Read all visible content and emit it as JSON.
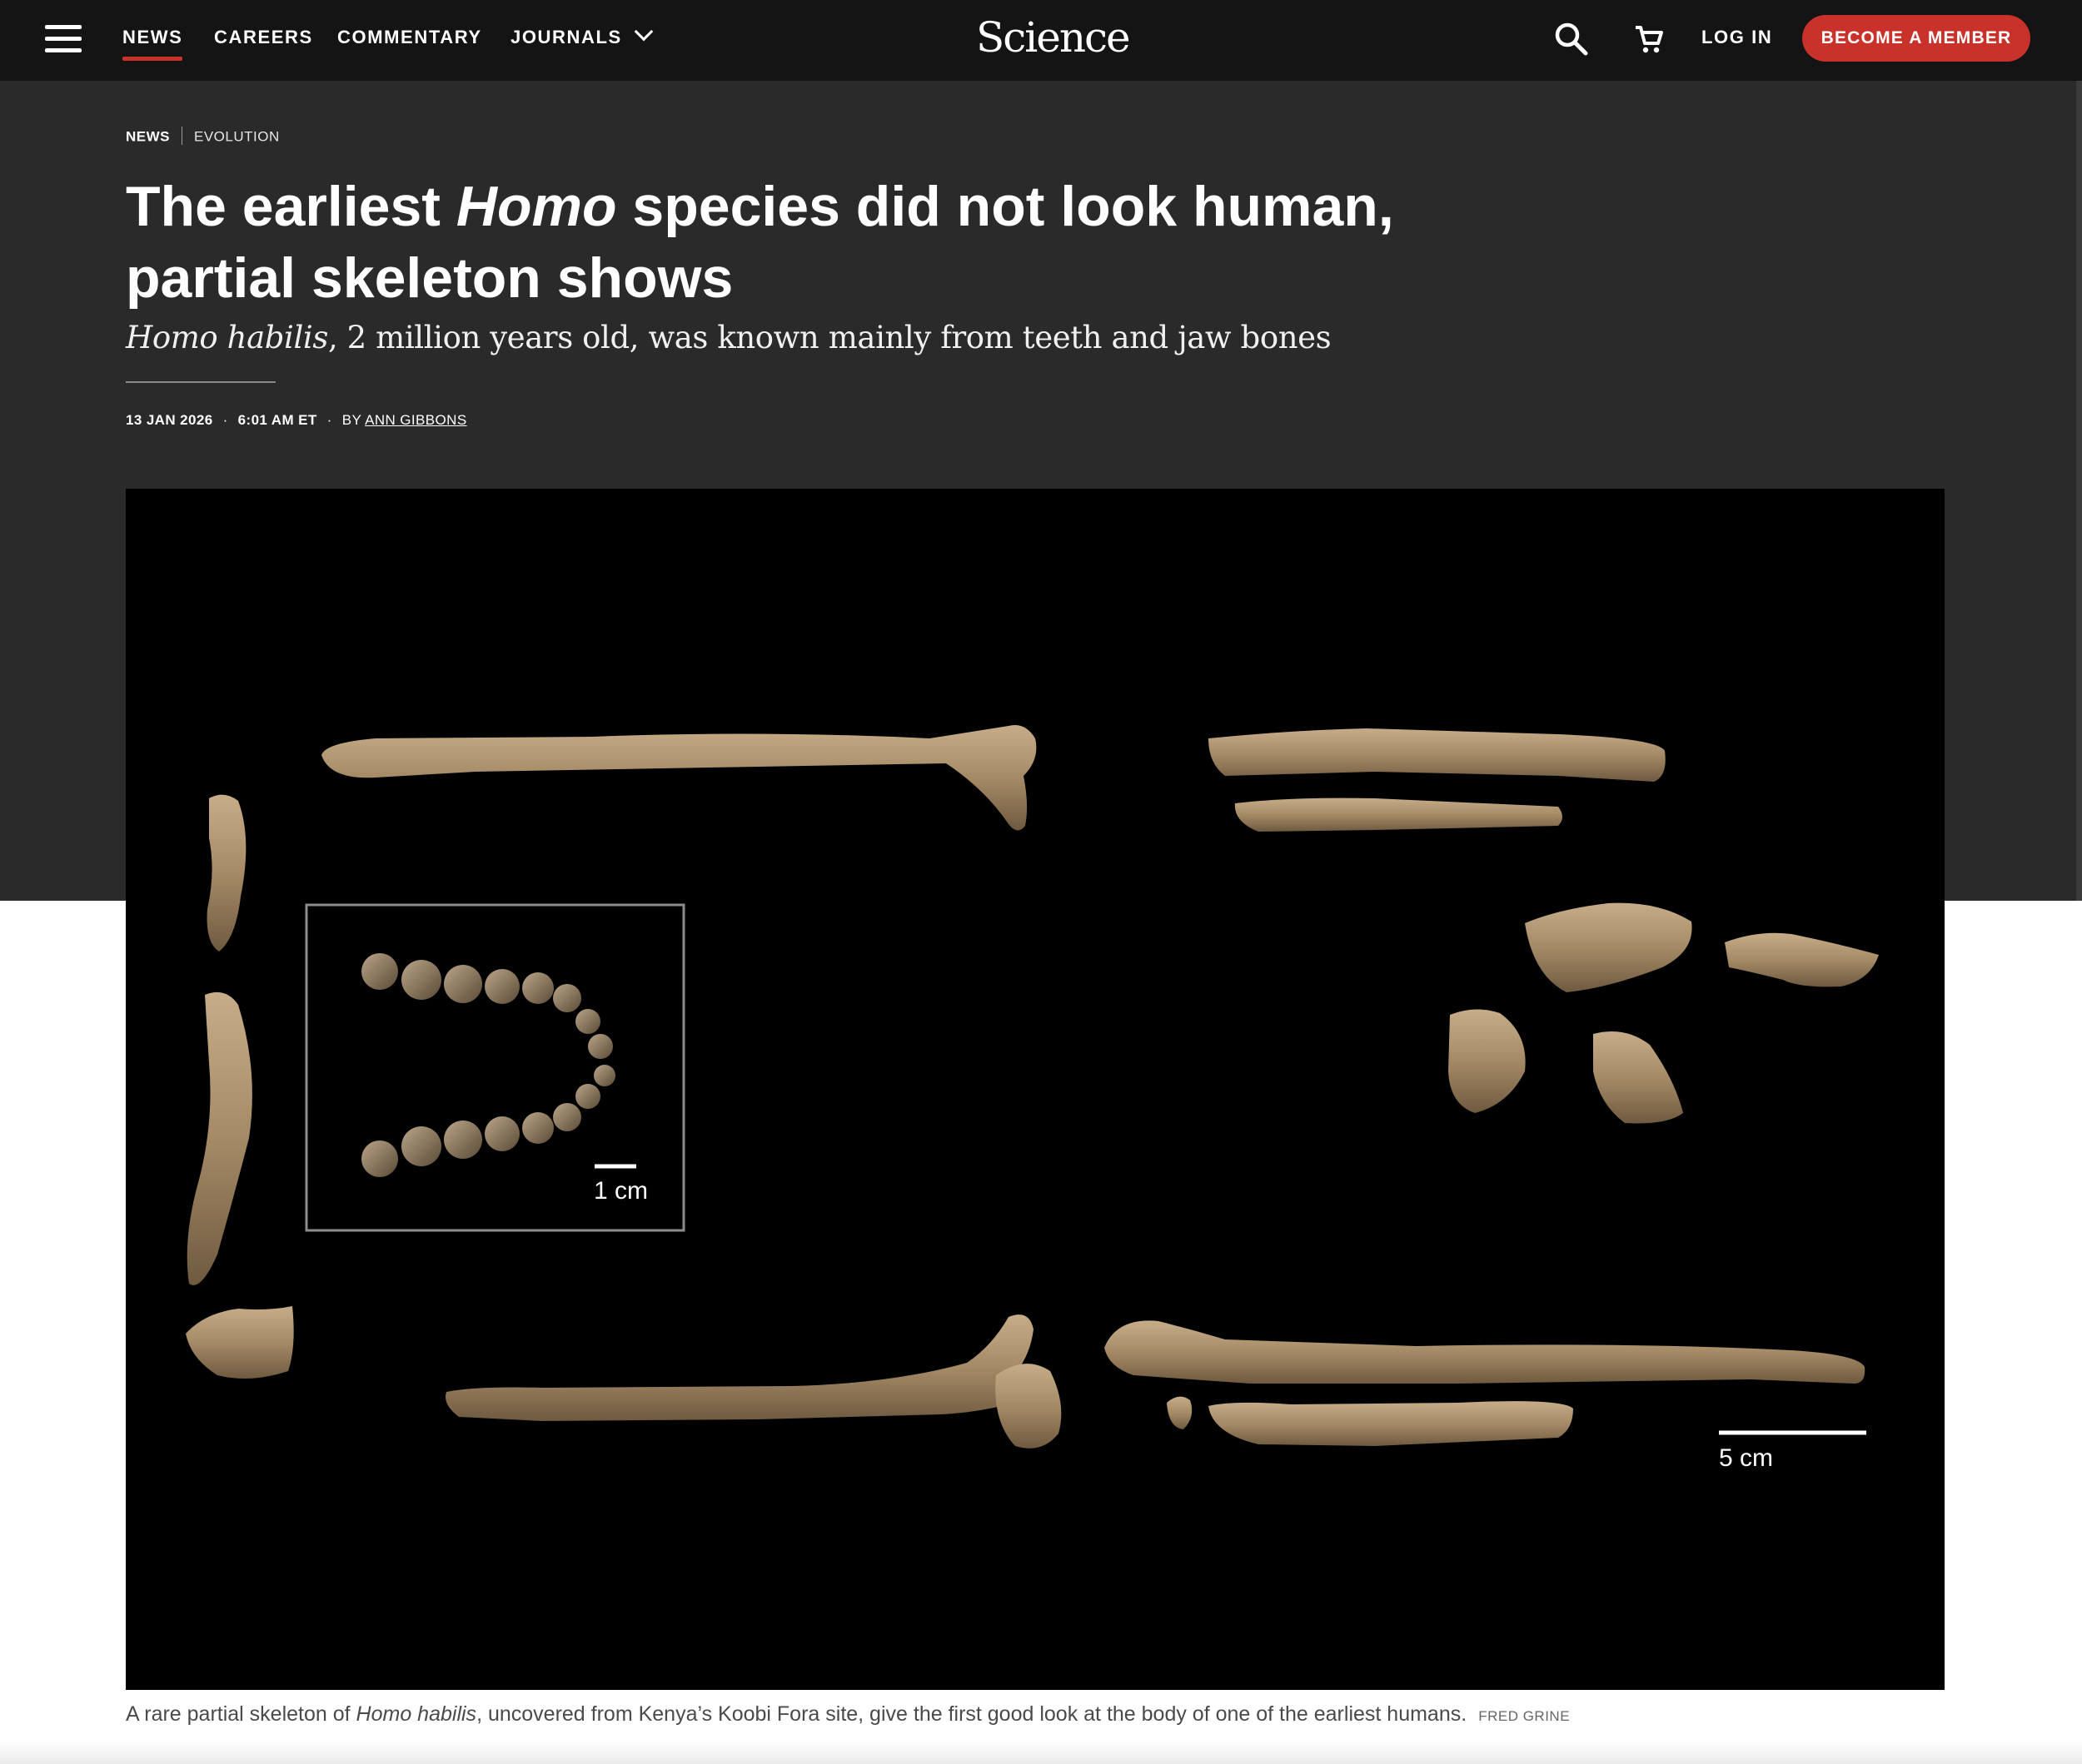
{
  "nav": {
    "links": [
      "NEWS",
      "CAREERS",
      "COMMENTARY",
      "JOURNALS"
    ],
    "logo": "Science",
    "login": "LOG IN",
    "member": "BECOME A MEMBER"
  },
  "article": {
    "breadcrumb": {
      "section": "NEWS",
      "topic": "EVOLUTION"
    },
    "headline": {
      "pre": "The earliest ",
      "em": "Homo",
      "post": " species did not look human, partial skeleton shows"
    },
    "dek": {
      "em": "Homo habilis",
      "rest": ", 2 million years old, was known mainly from teeth and jaw bones"
    },
    "meta": {
      "date": "13 JAN 2026",
      "time": "6:01 AM ET",
      "by": "BY",
      "author": "ANN GIBBONS"
    }
  },
  "figure": {
    "inset_scale": "1 cm",
    "main_scale": "5 cm",
    "caption_pre": "A rare partial skeleton of ",
    "caption_em": "Homo habilis",
    "caption_post": ", uncovered from Kenya’s Koobi Fora site, give the first good look at the body of one of the earliest humans.",
    "credit": "FRED GRINE"
  },
  "colors": {
    "brand_red": "#c8322a",
    "nav_bg": "#141414",
    "hero_bg": "#2a2a2a",
    "bone": "#a88d6b"
  }
}
